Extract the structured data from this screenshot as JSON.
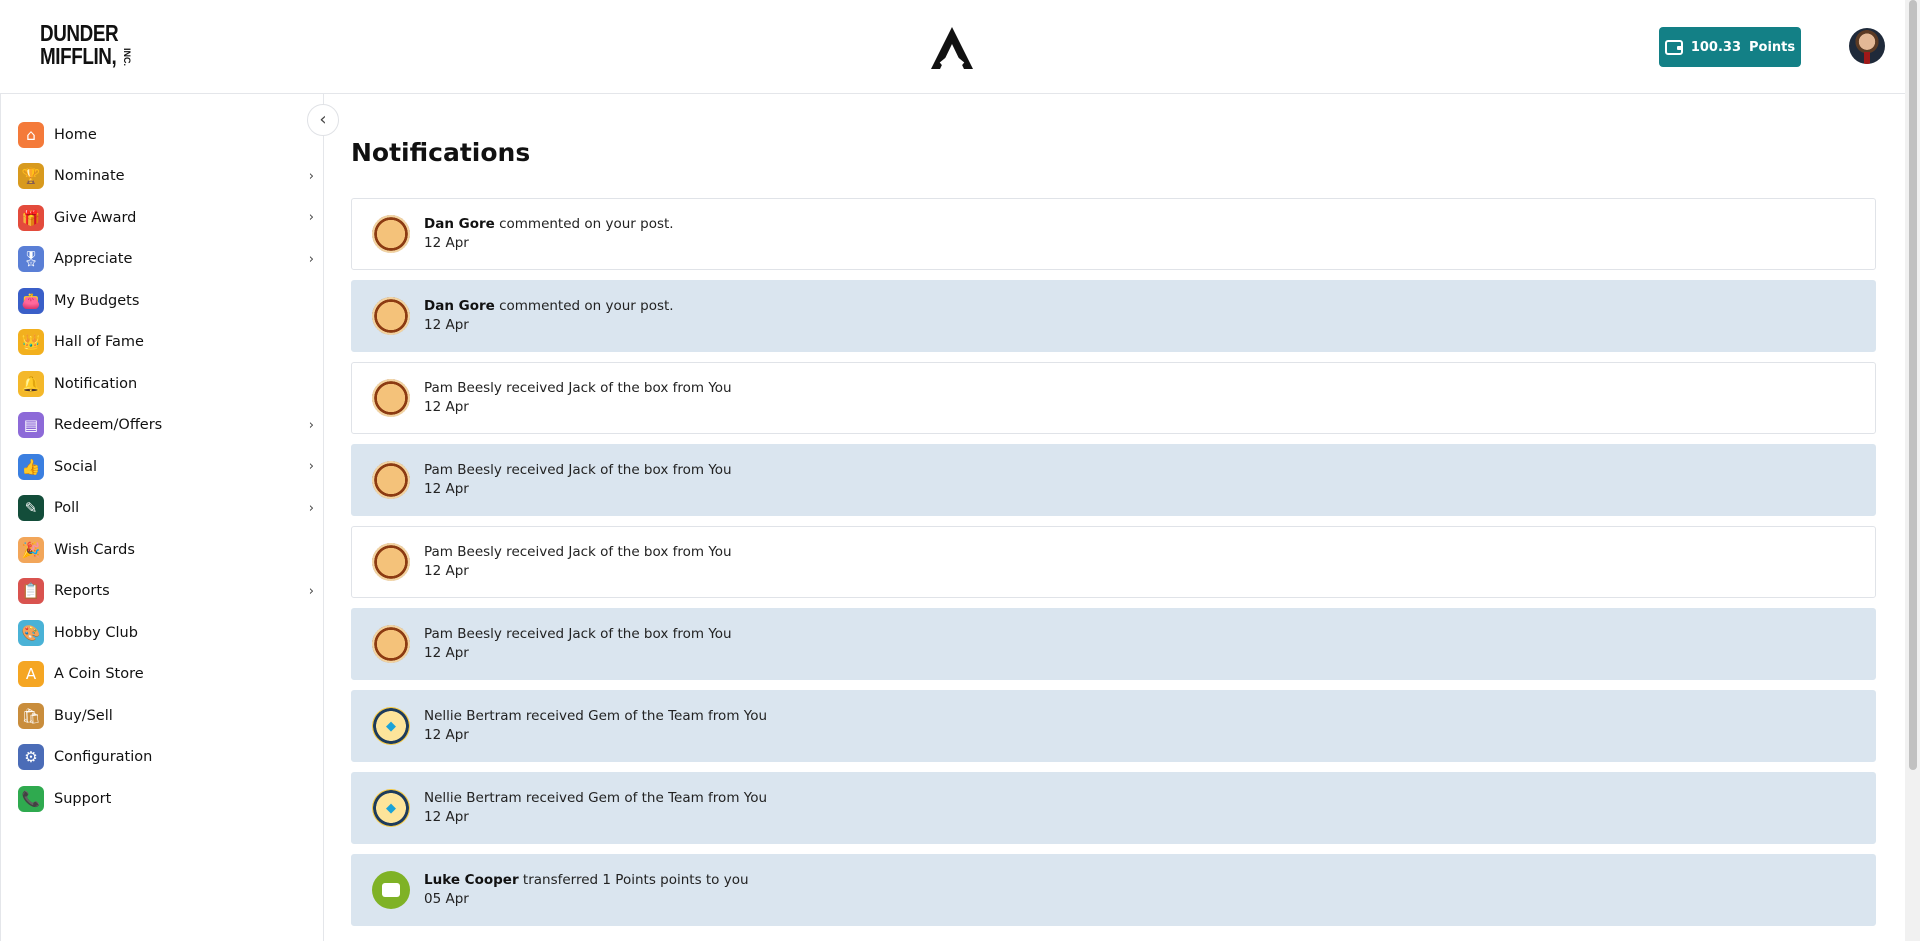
{
  "header": {
    "logo_line1": "DUNDER",
    "logo_line2": "MIFFLIN,",
    "logo_inc": "INC.",
    "points_value": "100.33",
    "points_label": "Points",
    "accent": "#138086"
  },
  "sidebar": {
    "items": [
      {
        "label": "Home",
        "icon": "house-icon",
        "color": "#f47a3a",
        "glyph": "⌂",
        "chevron": false
      },
      {
        "label": "Nominate",
        "icon": "trophy-icon",
        "color": "#d89a1e",
        "glyph": "🏆",
        "chevron": true
      },
      {
        "label": "Give Award",
        "icon": "gift-icon",
        "color": "#e34b3c",
        "glyph": "🎁",
        "chevron": true
      },
      {
        "label": "Appreciate",
        "icon": "medal-icon",
        "color": "#5a7fd6",
        "glyph": "🎖",
        "chevron": true
      },
      {
        "label": "My Budgets",
        "icon": "wallet-icon",
        "color": "#3a5fc8",
        "glyph": "👛",
        "chevron": false
      },
      {
        "label": "Hall of Fame",
        "icon": "crown-icon",
        "color": "#f2b01e",
        "glyph": "👑",
        "chevron": false
      },
      {
        "label": "Notification",
        "icon": "bell-icon",
        "color": "#f4b82a",
        "glyph": "🔔",
        "chevron": false
      },
      {
        "label": "Redeem/Offers",
        "icon": "voucher-icon",
        "color": "#8d6ad8",
        "glyph": "▤",
        "chevron": true
      },
      {
        "label": "Social",
        "icon": "like-icon",
        "color": "#3b7fe0",
        "glyph": "👍",
        "chevron": true
      },
      {
        "label": "Poll",
        "icon": "poll-icon",
        "color": "#134d3a",
        "glyph": "✎",
        "chevron": true
      },
      {
        "label": "Wish Cards",
        "icon": "party-popper-icon",
        "color": "#f2a65a",
        "glyph": "🎉",
        "chevron": false
      },
      {
        "label": "Reports",
        "icon": "clipboard-icon",
        "color": "#d9534f",
        "glyph": "📋",
        "chevron": true
      },
      {
        "label": "Hobby Club",
        "icon": "palette-icon",
        "color": "#4ab2d6",
        "glyph": "🎨",
        "chevron": false
      },
      {
        "label": "A Coin Store",
        "icon": "coin-icon",
        "color": "#f5a623",
        "glyph": "A",
        "chevron": false
      },
      {
        "label": "Buy/Sell",
        "icon": "shopping-bags-icon",
        "color": "#c98d3c",
        "glyph": "🛍",
        "chevron": false
      },
      {
        "label": "Configuration",
        "icon": "config-icon",
        "color": "#4b6cb7",
        "glyph": "⚙",
        "chevron": false
      },
      {
        "label": "Support",
        "icon": "phone-icon",
        "color": "#2faa4f",
        "glyph": "📞",
        "chevron": false
      }
    ]
  },
  "main": {
    "title": "Notifications",
    "notifications": [
      {
        "actor": "Dan Gore",
        "message": " commented on your post.",
        "date": "12 Apr",
        "badge": "jack",
        "unread": false
      },
      {
        "actor": "Dan Gore",
        "message": " commented on your post.",
        "date": "12 Apr",
        "badge": "jack",
        "unread": true
      },
      {
        "actor": "",
        "message": "Pam Beesly received Jack of the box from You",
        "date": "12 Apr",
        "badge": "jack",
        "unread": false
      },
      {
        "actor": "",
        "message": "Pam Beesly received Jack of the box from You",
        "date": "12 Apr",
        "badge": "jack",
        "unread": true
      },
      {
        "actor": "",
        "message": "Pam Beesly received Jack of the box from You",
        "date": "12 Apr",
        "badge": "jack",
        "unread": false
      },
      {
        "actor": "",
        "message": "Pam Beesly received Jack of the box from You",
        "date": "12 Apr",
        "badge": "jack",
        "unread": true
      },
      {
        "actor": "",
        "message": "Nellie Bertram received Gem of the Team from You",
        "date": "12 Apr",
        "badge": "gem",
        "unread": true
      },
      {
        "actor": "",
        "message": "Nellie Bertram received Gem of the Team from You",
        "date": "12 Apr",
        "badge": "gem",
        "unread": true
      },
      {
        "actor": "Luke Cooper",
        "message": " transferred 1 Points points to you",
        "date": "05 Apr",
        "badge": "wallet",
        "unread": true
      }
    ]
  }
}
